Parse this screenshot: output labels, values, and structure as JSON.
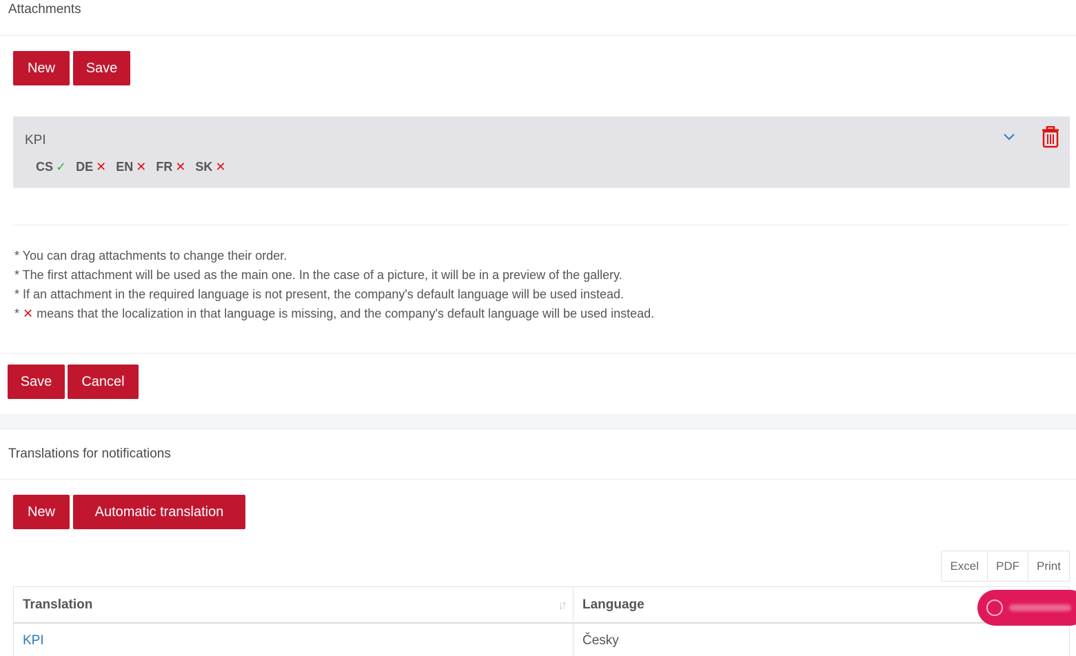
{
  "attachments": {
    "title": "Attachments",
    "new_label": "New",
    "save_label": "Save",
    "item": {
      "name": "KPI",
      "languages": [
        {
          "code": "CS",
          "status": "ok",
          "mark": "✓"
        },
        {
          "code": "DE",
          "status": "missing",
          "mark": "✕"
        },
        {
          "code": "EN",
          "status": "missing",
          "mark": "✕"
        },
        {
          "code": "FR",
          "status": "missing",
          "mark": "✕"
        },
        {
          "code": "SK",
          "status": "missing",
          "mark": "✕"
        }
      ],
      "expand_icon": "chevron-down-icon",
      "delete_icon": "trash-icon"
    },
    "notes": {
      "line1": "* You can drag attachments to change their order.",
      "line2": "* The first attachment will be used as the main one. In the case of a picture, it will be in a preview of the gallery.",
      "line3": "* If an attachment in the required language is not present, the company's default language will be used instead.",
      "line4_prefix": "* ",
      "line4_mark": "✕",
      "line4_text": " means that the localization in that language is missing, and the company's default language will be used instead."
    }
  },
  "form_actions": {
    "save_label": "Save",
    "cancel_label": "Cancel"
  },
  "translations": {
    "title": "Translations for notifications",
    "new_label": "New",
    "auto_label": "Automatic translation",
    "export": {
      "excel": "Excel",
      "pdf": "PDF",
      "print": "Print"
    },
    "columns": {
      "translation": "Translation",
      "language": "Language"
    },
    "rows": [
      {
        "translation": "KPI",
        "language": "Česky"
      }
    ]
  },
  "colors": {
    "primary": "#c0172f",
    "ok": "#3cb043",
    "missing": "#e01010",
    "link": "#2a7ab8",
    "card_bg": "#e4e4e8",
    "pill": "#e0195a"
  }
}
